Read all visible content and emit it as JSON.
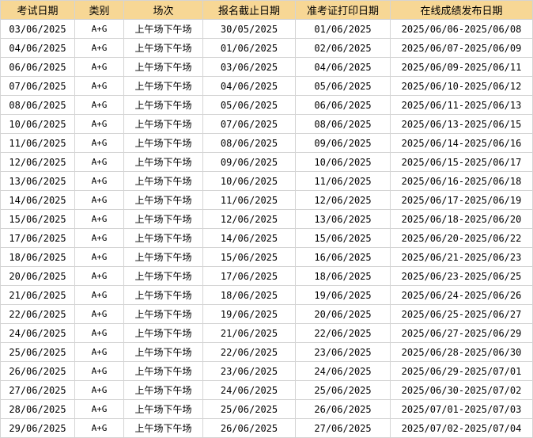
{
  "headers": [
    "考试日期",
    "类别",
    "场次",
    "报名截止日期",
    "准考证打印日期",
    "在线成绩发布日期"
  ],
  "rows": [
    [
      "03/06/2025",
      "A+G",
      "上午场下午场",
      "30/05/2025",
      "01/06/2025",
      "2025/06/06-2025/06/08"
    ],
    [
      "04/06/2025",
      "A+G",
      "上午场下午场",
      "01/06/2025",
      "02/06/2025",
      "2025/06/07-2025/06/09"
    ],
    [
      "06/06/2025",
      "A+G",
      "上午场下午场",
      "03/06/2025",
      "04/06/2025",
      "2025/06/09-2025/06/11"
    ],
    [
      "07/06/2025",
      "A+G",
      "上午场下午场",
      "04/06/2025",
      "05/06/2025",
      "2025/06/10-2025/06/12"
    ],
    [
      "08/06/2025",
      "A+G",
      "上午场下午场",
      "05/06/2025",
      "06/06/2025",
      "2025/06/11-2025/06/13"
    ],
    [
      "10/06/2025",
      "A+G",
      "上午场下午场",
      "07/06/2025",
      "08/06/2025",
      "2025/06/13-2025/06/15"
    ],
    [
      "11/06/2025",
      "A+G",
      "上午场下午场",
      "08/06/2025",
      "09/06/2025",
      "2025/06/14-2025/06/16"
    ],
    [
      "12/06/2025",
      "A+G",
      "上午场下午场",
      "09/06/2025",
      "10/06/2025",
      "2025/06/15-2025/06/17"
    ],
    [
      "13/06/2025",
      "A+G",
      "上午场下午场",
      "10/06/2025",
      "11/06/2025",
      "2025/06/16-2025/06/18"
    ],
    [
      "14/06/2025",
      "A+G",
      "上午场下午场",
      "11/06/2025",
      "12/06/2025",
      "2025/06/17-2025/06/19"
    ],
    [
      "15/06/2025",
      "A+G",
      "上午场下午场",
      "12/06/2025",
      "13/06/2025",
      "2025/06/18-2025/06/20"
    ],
    [
      "17/06/2025",
      "A+G",
      "上午场下午场",
      "14/06/2025",
      "15/06/2025",
      "2025/06/20-2025/06/22"
    ],
    [
      "18/06/2025",
      "A+G",
      "上午场下午场",
      "15/06/2025",
      "16/06/2025",
      "2025/06/21-2025/06/23"
    ],
    [
      "20/06/2025",
      "A+G",
      "上午场下午场",
      "17/06/2025",
      "18/06/2025",
      "2025/06/23-2025/06/25"
    ],
    [
      "21/06/2025",
      "A+G",
      "上午场下午场",
      "18/06/2025",
      "19/06/2025",
      "2025/06/24-2025/06/26"
    ],
    [
      "22/06/2025",
      "A+G",
      "上午场下午场",
      "19/06/2025",
      "20/06/2025",
      "2025/06/25-2025/06/27"
    ],
    [
      "24/06/2025",
      "A+G",
      "上午场下午场",
      "21/06/2025",
      "22/06/2025",
      "2025/06/27-2025/06/29"
    ],
    [
      "25/06/2025",
      "A+G",
      "上午场下午场",
      "22/06/2025",
      "23/06/2025",
      "2025/06/28-2025/06/30"
    ],
    [
      "26/06/2025",
      "A+G",
      "上午场下午场",
      "23/06/2025",
      "24/06/2025",
      "2025/06/29-2025/07/01"
    ],
    [
      "27/06/2025",
      "A+G",
      "上午场下午场",
      "24/06/2025",
      "25/06/2025",
      "2025/06/30-2025/07/02"
    ],
    [
      "28/06/2025",
      "A+G",
      "上午场下午场",
      "25/06/2025",
      "26/06/2025",
      "2025/07/01-2025/07/03"
    ],
    [
      "29/06/2025",
      "A+G",
      "上午场下午场",
      "26/06/2025",
      "27/06/2025",
      "2025/07/02-2025/07/04"
    ]
  ],
  "colors": {
    "header_bg": "#f7d795",
    "grid": "#d4d4d4"
  }
}
